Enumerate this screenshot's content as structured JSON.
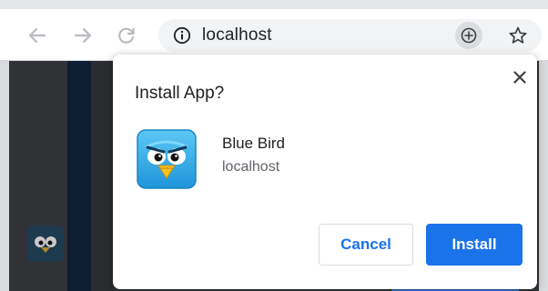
{
  "browser": {
    "url": "localhost",
    "icons": {
      "back": "arrow-left-icon",
      "forward": "arrow-right-icon",
      "reload": "reload-icon",
      "info": "info-icon",
      "install": "install-plus-icon",
      "bookmark": "star-icon"
    }
  },
  "dialog": {
    "title": "Install App?",
    "app_name": "Blue Bird",
    "app_origin": "localhost",
    "cancel_label": "Cancel",
    "install_label": "Install",
    "close_icon": "close-icon"
  },
  "colors": {
    "accent": "#1a73e8",
    "app_icon_blue": "#2aa7e8"
  }
}
